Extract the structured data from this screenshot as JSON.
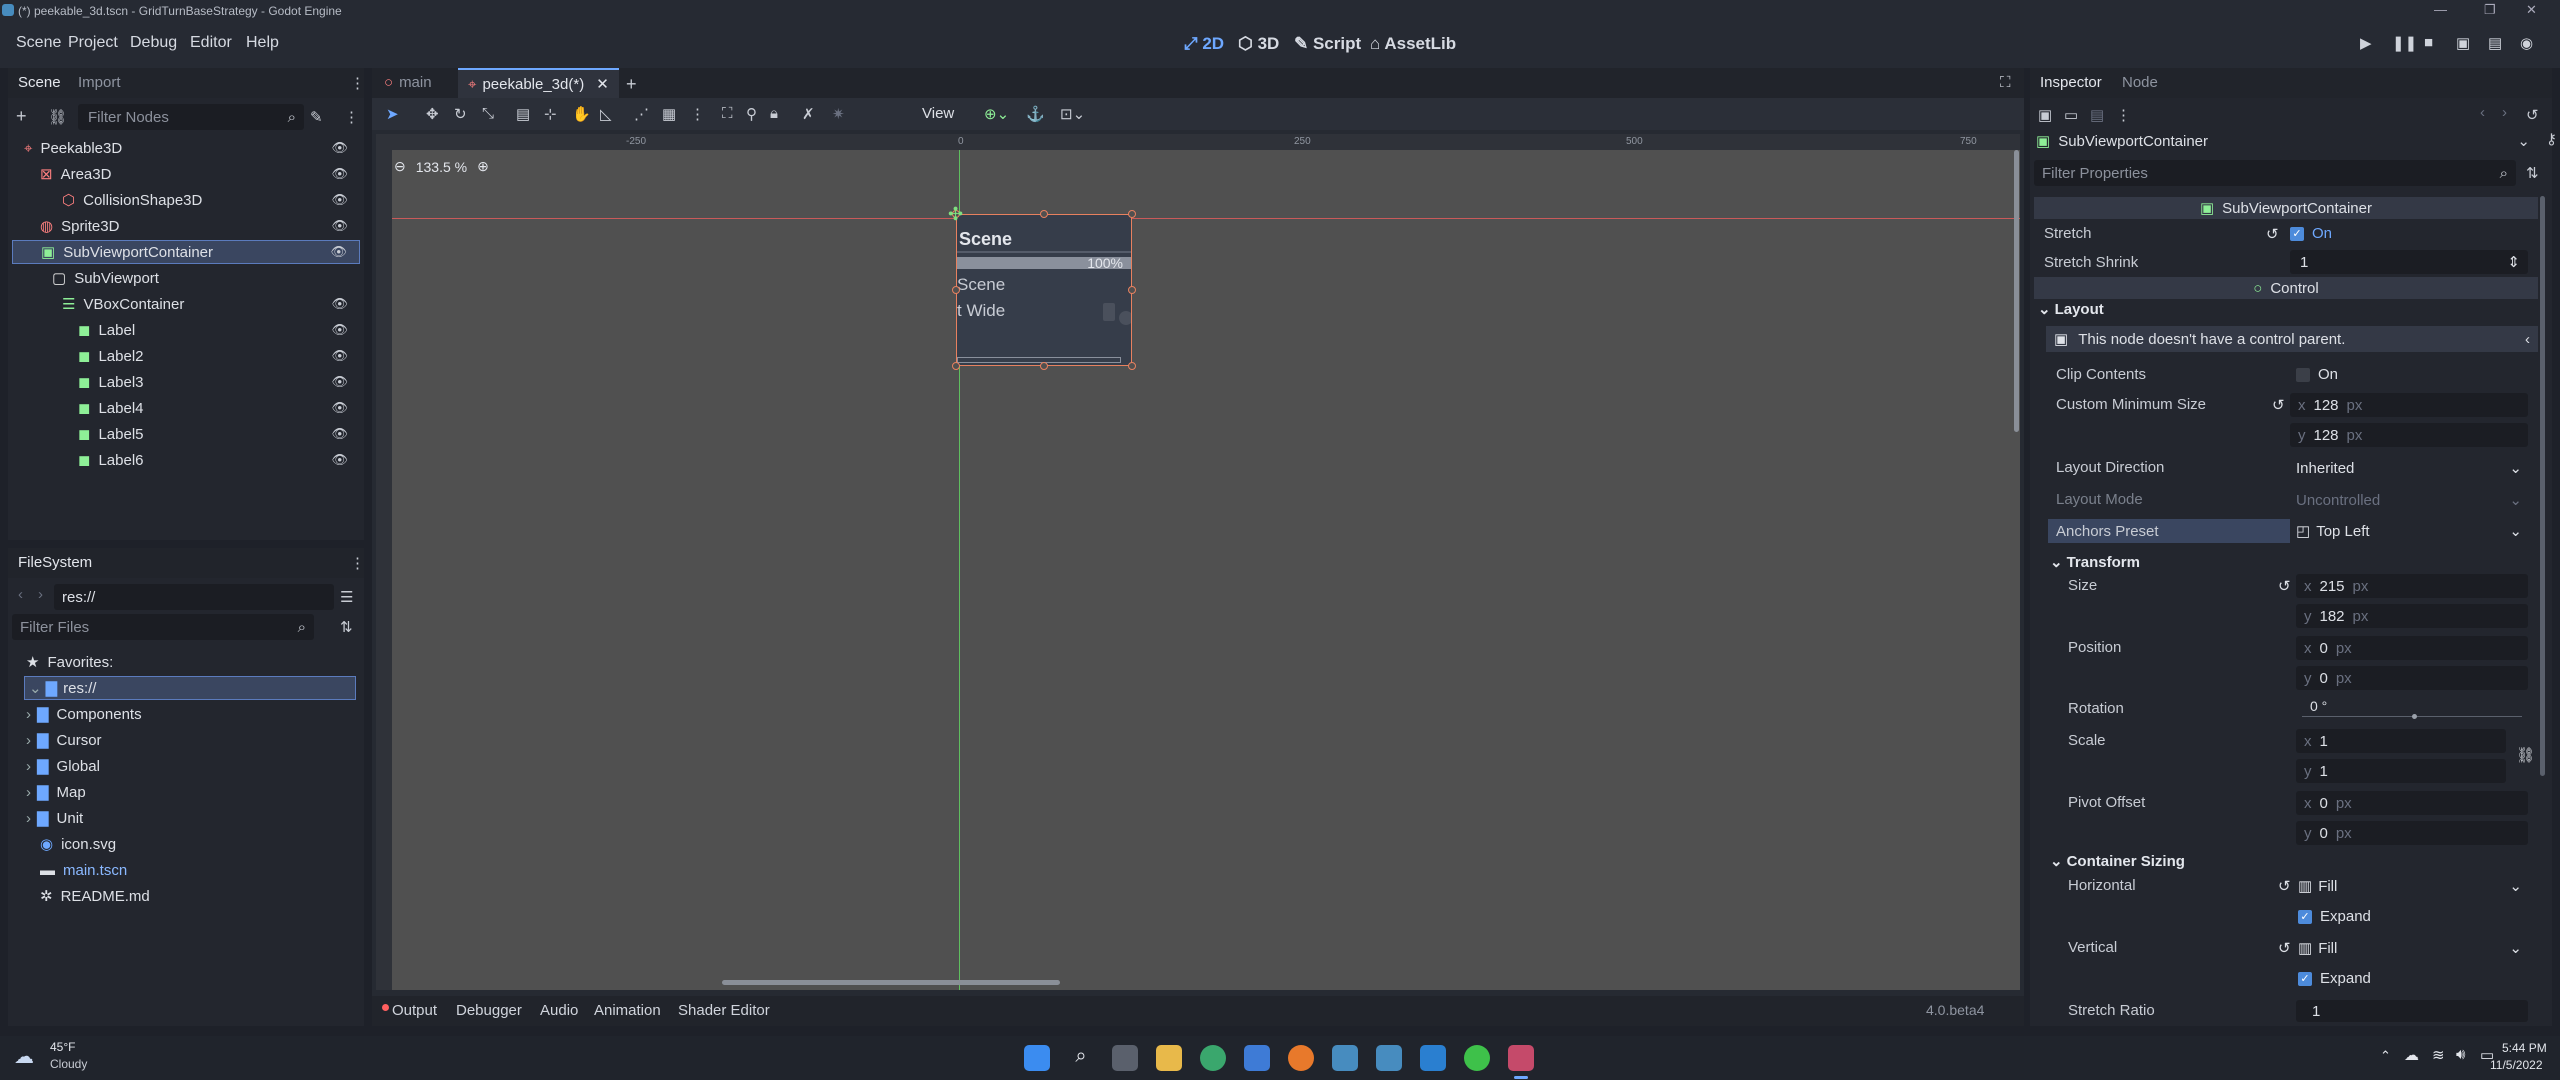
{
  "window": {
    "title": "(*) peekable_3d.tscn - GridTurnBaseStrategy - Godot Engine"
  },
  "menu": [
    "Scene",
    "Project",
    "Debug",
    "Editor",
    "Help"
  ],
  "workspaces": [
    "2D",
    "3D",
    "Script",
    "AssetLib"
  ],
  "scene_dock": {
    "tabs": [
      "Scene",
      "Import"
    ],
    "filter_placeholder": "Filter Nodes",
    "nodes": [
      {
        "label": "Peekable3D",
        "icon": "node3d-icon",
        "color": "#fc7f7f"
      },
      {
        "label": "Area3D",
        "icon": "area3d-icon",
        "color": "#fc7f7f"
      },
      {
        "label": "CollisionShape3D",
        "icon": "collisionshape-icon",
        "color": "#fc7f7f"
      },
      {
        "label": "Sprite3D",
        "icon": "sprite3d-icon",
        "color": "#fc7f7f"
      },
      {
        "label": "SubViewportContainer",
        "icon": "subviewportcontainer-icon",
        "color": "#8eef97"
      },
      {
        "label": "SubViewport",
        "icon": "subviewport-icon",
        "color": "#e0e0e0"
      },
      {
        "label": "VBoxContainer",
        "icon": "vboxcontainer-icon",
        "color": "#8eef97"
      },
      {
        "label": "Label",
        "icon": "label-icon",
        "color": "#8eef97"
      },
      {
        "label": "Label2",
        "icon": "label-icon",
        "color": "#8eef97"
      },
      {
        "label": "Label3",
        "icon": "label-icon",
        "color": "#8eef97"
      },
      {
        "label": "Label4",
        "icon": "label-icon",
        "color": "#8eef97"
      },
      {
        "label": "Label5",
        "icon": "label-icon",
        "color": "#8eef97"
      },
      {
        "label": "Label6",
        "icon": "label-icon",
        "color": "#8eef97"
      }
    ]
  },
  "filesystem": {
    "title": "FileSystem",
    "path": "res://",
    "filter_placeholder": "Filter Files",
    "favorites": "Favorites:",
    "root": "res://",
    "items": [
      {
        "label": "Components",
        "type": "folder"
      },
      {
        "label": "Cursor",
        "type": "folder"
      },
      {
        "label": "Global",
        "type": "folder"
      },
      {
        "label": "Map",
        "type": "folder"
      },
      {
        "label": "Unit",
        "type": "folder"
      },
      {
        "label": "icon.svg",
        "type": "image"
      },
      {
        "label": "main.tscn",
        "type": "scene"
      },
      {
        "label": "README.md",
        "type": "text"
      }
    ]
  },
  "editor_tabs": [
    "main",
    "peekable_3d(*)"
  ],
  "toolbar": {
    "view_label": "View"
  },
  "viewport": {
    "zoom": "133.5 %",
    "ruler_marks": [
      "-250",
      "0",
      "250",
      "500",
      "750"
    ],
    "preview": {
      "title": "Scene",
      "progress_text": "100%",
      "progress": 1.0,
      "line1": "Scene",
      "line2": "t Wide"
    }
  },
  "bottom_panel": {
    "tabs": [
      "Output",
      "Debugger",
      "Audio",
      "Animation",
      "Shader Editor"
    ],
    "version": "4.0.beta4"
  },
  "inspector": {
    "tabs": [
      "Inspector",
      "Node"
    ],
    "object": "SubViewportContainer",
    "filter_placeholder": "Filter Properties",
    "class_header": "SubViewportContainer",
    "stretch_label": "Stretch",
    "stretch_value": "On",
    "stretch_shrink_label": "Stretch Shrink",
    "stretch_shrink_value": "1",
    "control_header": "Control",
    "layout_cat": "Layout",
    "warning": "This node doesn't have a control parent.",
    "clip_contents_label": "Clip Contents",
    "clip_contents_value": "On",
    "min_size_label": "Custom Minimum Size",
    "min_x": "128",
    "min_y": "128",
    "layout_direction_label": "Layout Direction",
    "layout_direction_value": "Inherited",
    "layout_mode_label": "Layout Mode",
    "layout_mode_value": "Uncontrolled",
    "anchors_label": "Anchors Preset",
    "anchors_value": "Top Left",
    "transform_cat": "Transform",
    "size_label": "Size",
    "size_x": "215",
    "size_y": "182",
    "position_label": "Position",
    "pos_x": "0",
    "pos_y": "0",
    "rotation_label": "Rotation",
    "rotation_value": "0 °",
    "scale_label": "Scale",
    "scale_x": "1",
    "scale_y": "1",
    "pivot_label": "Pivot Offset",
    "pivot_x": "0",
    "pivot_y": "0",
    "container_cat": "Container Sizing",
    "horizontal_label": "Horizontal",
    "horizontal_value": "Fill",
    "expand_label": "Expand",
    "vertical_label": "Vertical",
    "vertical_value": "Fill",
    "stretch_ratio_label": "Stretch Ratio",
    "stretch_ratio_value": "1",
    "px": "px"
  },
  "taskbar": {
    "weather_temp": "45°F",
    "weather_desc": "Cloudy",
    "time": "5:44 PM",
    "date": "11/5/2022"
  }
}
